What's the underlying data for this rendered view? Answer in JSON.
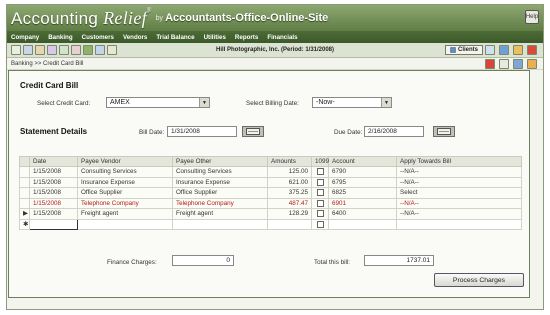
{
  "app": {
    "brand_main": "Accounting ",
    "brand_italic": "Relief",
    "brand_tm": "®",
    "brand_by": "by",
    "site_name": "Accountants-Office-Online-Site",
    "help_label": "Help"
  },
  "menu": [
    "Company",
    "Banking",
    "Customers",
    "Vendors",
    "Trial Balance",
    "Utilities",
    "Reports",
    "Financials"
  ],
  "toolbar": {
    "company_period": "Hill Photographic, Inc. (Period: 1/31/2008)",
    "clients_label": "Clients"
  },
  "breadcrumb": "Banking >> Credit Card Bill",
  "form": {
    "title": "Credit Card Bill",
    "credit_card_label": "Select Credit Card:",
    "credit_card_value": "AMEX",
    "billing_date_label": "Select Billing Date:",
    "billing_date_value": "-Now-",
    "statement_title": "Statement Details",
    "bill_date_label": "Bill Date:",
    "bill_date_value": "1/31/2008",
    "due_date_label": "Due Date:",
    "due_date_value": "2/16/2008"
  },
  "grid": {
    "headers": [
      "Date",
      "Payee Vendor",
      "Payee Other",
      "Amounts",
      "1099",
      "Account",
      "Apply Towards Bill"
    ],
    "rows": [
      {
        "marker": "",
        "date": "1/15/2008",
        "vendor": "Consulting Services",
        "other": "Consulting Services",
        "amount": "125.00",
        "account": "6790",
        "apply": "--N/A--",
        "red": false
      },
      {
        "marker": "",
        "date": "1/15/2008",
        "vendor": "Insurance Expense",
        "other": "Insurance Expense",
        "amount": "621.00",
        "account": "6795",
        "apply": "--N/A--",
        "red": false
      },
      {
        "marker": "",
        "date": "1/15/2008",
        "vendor": "Office Supplier",
        "other": "Office Supplier",
        "amount": "375.25",
        "account": "6825",
        "apply": "Select",
        "red": false
      },
      {
        "marker": "",
        "date": "1/15/2008",
        "vendor": "Telephone Company",
        "other": "Telephone Company",
        "amount": "487.47",
        "account": "6901",
        "apply": "--N/A--",
        "red": true
      },
      {
        "marker": "▶",
        "date": "1/15/2008",
        "vendor": "Freight agent",
        "other": "Freight agent",
        "amount": "128.29",
        "account": "6400",
        "apply": "--N/A--",
        "red": false
      }
    ],
    "new_row_marker": "✱"
  },
  "footer": {
    "finance_charges_label": "Finance Charges:",
    "finance_charges_value": "0",
    "total_label": "Total this bill:",
    "total_value": "1737.01",
    "process_button": "Process Charges"
  }
}
